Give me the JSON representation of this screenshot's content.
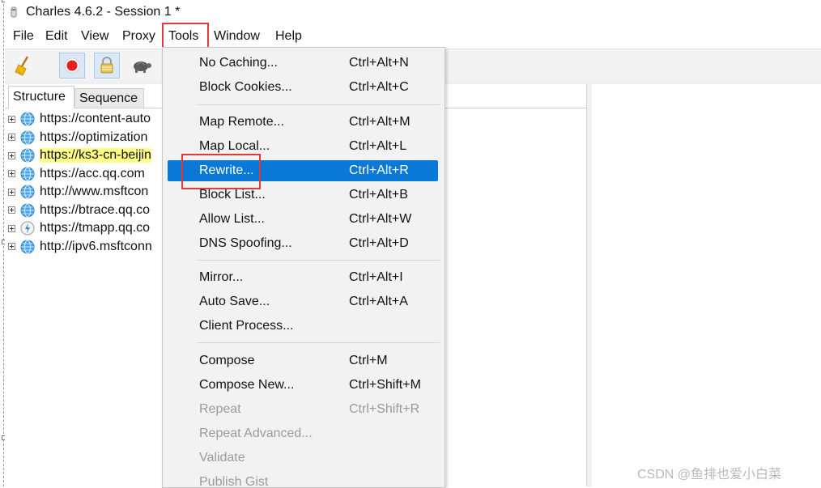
{
  "window": {
    "title": "Charles 4.6.2 - Session 1 *"
  },
  "menubar": [
    {
      "label": "File"
    },
    {
      "label": "Edit"
    },
    {
      "label": "View"
    },
    {
      "label": "Proxy"
    },
    {
      "label": "Tools"
    },
    {
      "label": "Window"
    },
    {
      "label": "Help"
    }
  ],
  "toolbar": {
    "buttons": [
      {
        "icon": "broom-icon"
      },
      {
        "icon": "record-icon"
      },
      {
        "icon": "lock-icon"
      },
      {
        "icon": "turtle-icon"
      }
    ]
  },
  "tabs": [
    {
      "label": "Structure"
    },
    {
      "label": "Sequence"
    }
  ],
  "tree": [
    {
      "host": "https://content-auto",
      "icon": "globe-icon"
    },
    {
      "host": "https://optimization",
      "icon": "globe-icon"
    },
    {
      "host": "https://ks3-cn-beijin",
      "icon": "globe-icon",
      "highlight": true
    },
    {
      "host": "https://acc.qq.com",
      "icon": "globe-icon"
    },
    {
      "host": "http://www.msftcon",
      "icon": "globe-icon"
    },
    {
      "host": "https://btrace.qq.co",
      "icon": "globe-icon"
    },
    {
      "host": "https://tmapp.qq.co",
      "icon": "bolt-icon"
    },
    {
      "host": "http://ipv6.msftconn",
      "icon": "globe-icon"
    }
  ],
  "tools_menu": {
    "groups": [
      [
        {
          "label": "No Caching...",
          "shortcut": "Ctrl+Alt+N"
        },
        {
          "label": "Block Cookies...",
          "shortcut": "Ctrl+Alt+C"
        }
      ],
      [
        {
          "label": "Map Remote...",
          "shortcut": "Ctrl+Alt+M"
        },
        {
          "label": "Map Local...",
          "shortcut": "Ctrl+Alt+L"
        },
        {
          "label": "Rewrite...",
          "shortcut": "Ctrl+Alt+R",
          "hover": true
        },
        {
          "label": "Block List...",
          "shortcut": "Ctrl+Alt+B"
        },
        {
          "label": "Allow List...",
          "shortcut": "Ctrl+Alt+W"
        },
        {
          "label": "DNS Spoofing...",
          "shortcut": "Ctrl+Alt+D"
        }
      ],
      [
        {
          "label": "Mirror...",
          "shortcut": "Ctrl+Alt+I"
        },
        {
          "label": "Auto Save...",
          "shortcut": "Ctrl+Alt+A"
        },
        {
          "label": "Client Process...",
          "shortcut": ""
        }
      ],
      [
        {
          "label": "Compose",
          "shortcut": "Ctrl+M"
        },
        {
          "label": "Compose New...",
          "shortcut": "Ctrl+Shift+M"
        },
        {
          "label": "Repeat",
          "shortcut": "Ctrl+Shift+R",
          "disabled": true
        },
        {
          "label": "Repeat Advanced...",
          "shortcut": "",
          "disabled": true
        },
        {
          "label": "Validate",
          "shortcut": "",
          "disabled": true
        },
        {
          "label": "Publish Gist",
          "shortcut": "",
          "disabled": true
        }
      ]
    ]
  },
  "colors": {
    "highlight": "#0a78d7",
    "annotation": "#e53935",
    "row_highlight": "#ffff88"
  },
  "watermark": "CSDN @鱼排也爱小白菜"
}
